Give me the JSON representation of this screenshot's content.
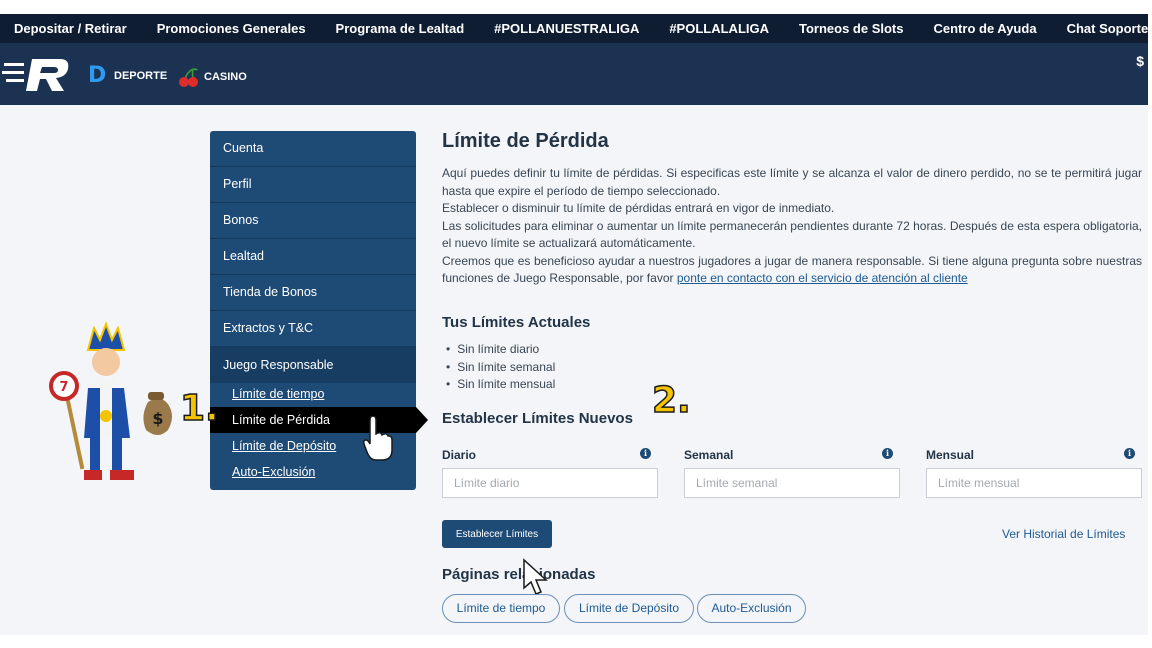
{
  "topnav": {
    "items": [
      "Depositar / Retirar",
      "Promociones Generales",
      "Programa de Lealtad",
      "#POLLANUESTRALIGA",
      "#POLLALALIGA",
      "Torneos de Slots",
      "Centro de Ayuda",
      "Chat Soporte"
    ]
  },
  "brandbar": {
    "deporte_label": "DEPORTE",
    "casino_label": "CASINO",
    "balance_partial": "$"
  },
  "sidebar": {
    "items": [
      "Cuenta",
      "Perfil",
      "Bonos",
      "Lealtad",
      "Tienda de Bonos",
      "Extractos y T&C"
    ],
    "group_label": "Juego Responsable",
    "sub_items": [
      "Límite de tiempo",
      "Límite de Pérdida",
      "Límite de Depósito",
      "Auto-Exclusión"
    ],
    "active_sub": "Límite de Pérdida"
  },
  "main": {
    "title": "Límite de Pérdida",
    "desc_1": "Aquí puedes definir tu límite de pérdidas. Si especificas este límite y se alcanza el valor de dinero perdido, no se te permitirá jugar hasta que expire el período de tiempo seleccionado.",
    "desc_2": "Establecer o disminuir tu límite de pérdidas entrará en vigor de inmediato.",
    "desc_3": "Las solicitudes para eliminar o aumentar un límite permanecerán pendientes durante 72 horas. Después de esta espera obligatoria, el nuevo límite se actualizará automáticamente.",
    "desc_4": "Creemos que es beneficioso ayudar a nuestros jugadores a jugar de manera responsable. Si tiene alguna pregunta sobre nuestras funciones de Juego Responsable, por favor",
    "desc_link": "ponte en contacto con el servicio de atención al cliente",
    "current_heading": "Tus Límites Actuales",
    "current_limits": [
      "Sin límite diario",
      "Sin límite semanal",
      "Sin límite mensual"
    ],
    "new_heading": "Establecer Límites Nuevos",
    "fields": [
      {
        "label": "Diario",
        "placeholder": "Límite diario"
      },
      {
        "label": "Semanal",
        "placeholder": "Límite semanal"
      },
      {
        "label": "Mensual",
        "placeholder": "Límite mensual"
      }
    ],
    "submit_label": "Establecer Límites",
    "history_link": "Ver Historial de Límites",
    "related_heading": "Páginas relacionadas",
    "related_pills": [
      "Límite de tiempo",
      "Límite de Depósito",
      "Auto-Exclusión"
    ]
  },
  "annotations": {
    "step_1": "1.",
    "step_2": "2."
  },
  "colors": {
    "topnav_bg": "#0f1d33",
    "brandbar_bg": "#1c3253",
    "sidebar_bg": "#1e4a76",
    "accent": "#1e4a76",
    "step_yellow": "#f5c400"
  }
}
